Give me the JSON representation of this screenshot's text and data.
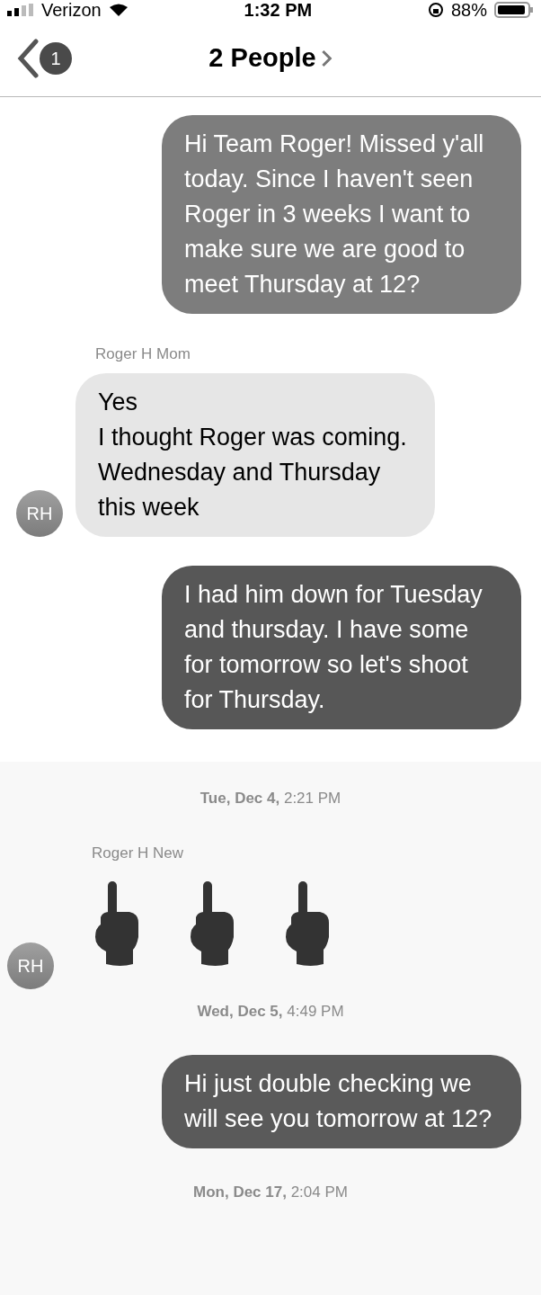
{
  "status_bar": {
    "carrier": "Verizon",
    "time": "1:32 PM",
    "battery": "88%"
  },
  "nav": {
    "back_badge": "1",
    "title": "2 People"
  },
  "sections": [
    {
      "shaded": false,
      "items": [
        {
          "kind": "sent",
          "color": "#7d7d7d",
          "text": "Hi Team Roger! Missed y'all today. Since I haven't seen Roger in 3 weeks I want to make sure we are good to meet Thursday at 12?"
        },
        {
          "kind": "received",
          "sender": "Roger H Mom",
          "avatar": "RH",
          "text": "Yes\nI thought Roger was coming. Wednesday and Thursday this week"
        },
        {
          "kind": "sent",
          "color": "#575757",
          "text": "I had him down for Tuesday and thursday. I have some for tomorrow so let's shoot for Thursday."
        }
      ]
    },
    {
      "shaded": true,
      "items": [
        {
          "kind": "timestamp",
          "text": "**Tue, Dec 4,** 2:21 PM"
        },
        {
          "kind": "emoji",
          "sender": "Roger H New",
          "avatar": "RH",
          "emojis": [
            {
              "kind": "middle-finger"
            },
            {
              "kind": "middle-finger"
            },
            {
              "kind": "middle-finger"
            }
          ]
        },
        {
          "kind": "timestamp",
          "text": "**Wed, Dec 5,** 4:49 PM"
        },
        {
          "kind": "sent",
          "color": "#5a5a5a",
          "text": "Hi just double checking we will see you tomorrow at 12?"
        },
        {
          "kind": "timestamp",
          "text": "**Mon, Dec 17,** 2:04 PM"
        }
      ]
    }
  ]
}
